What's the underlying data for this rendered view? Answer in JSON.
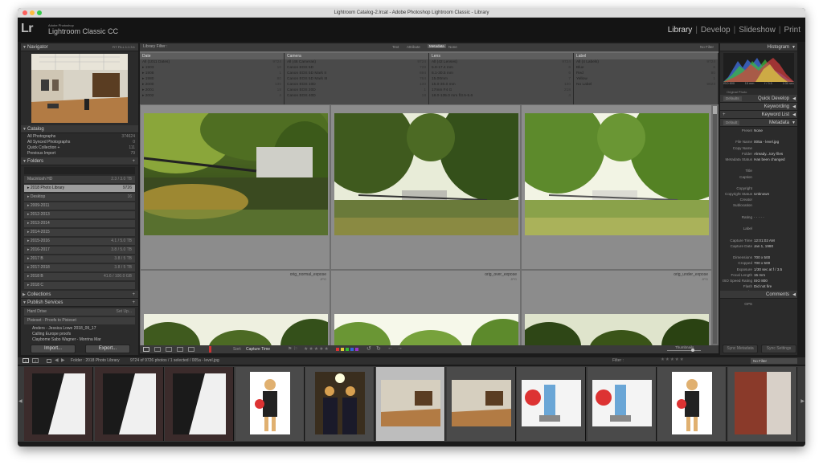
{
  "window": {
    "title": "Lightroom Catalog-2.lrcat - Adobe Photoshop Lightroom Classic - Library"
  },
  "brand": {
    "logo": "Lr",
    "line1": "Adobe Photoshop",
    "line2": "Lightroom Classic CC"
  },
  "modules": [
    {
      "label": "Library",
      "active": true
    },
    {
      "label": "Develop",
      "active": false
    },
    {
      "label": "Slideshow",
      "active": false
    },
    {
      "label": "Print",
      "active": false
    }
  ],
  "navigator": {
    "title": "Navigator",
    "zoom": "FIT   FILL   1:1   3:1"
  },
  "catalog": {
    "title": "Catalog",
    "items": [
      {
        "label": "All Photographs",
        "count": "374624"
      },
      {
        "label": "All Synced Photographs",
        "count": "0"
      },
      {
        "label": "Quick Collection +",
        "count": "111"
      },
      {
        "label": "Previous Import",
        "count": "79"
      }
    ]
  },
  "folders": {
    "title": "Folders",
    "items": [
      {
        "label": "",
        "count": "",
        "selected": false
      },
      {
        "label": "Macintosh HD",
        "count": "2.3 / 3.0 TB",
        "selected": false
      },
      {
        "label": "▸  2018 Photo Library",
        "count": "9726",
        "selected": true
      },
      {
        "label": "▸  Desktop",
        "count": "16",
        "selected": false
      },
      {
        "label": "▸  2009-2011",
        "count": "",
        "selected": false
      },
      {
        "label": "▸  2012-2013",
        "count": "",
        "selected": false
      },
      {
        "label": "▸  2013-2014",
        "count": "",
        "selected": false
      },
      {
        "label": "▸  2014-2015",
        "count": "",
        "selected": false
      },
      {
        "label": "▸  2015-2016",
        "count": "4.1 / 5.0 TB",
        "selected": false
      },
      {
        "label": "▸  2016-2017",
        "count": "3.8 / 5.0 TB",
        "selected": false
      },
      {
        "label": "▸  2017 B",
        "count": "3.8 / 5 TB",
        "selected": false
      },
      {
        "label": "▸  2017-2018",
        "count": "3.8 / 5 TB",
        "selected": false
      },
      {
        "label": "▸  2018 B",
        "count": "41.6 / 100.0 GB",
        "selected": false
      },
      {
        "label": "▸  2018 C",
        "count": "",
        "selected": false
      }
    ]
  },
  "collections": {
    "title": "Collections"
  },
  "publish": {
    "title": "Publish Services",
    "items": [
      {
        "label": "Hard Drive",
        "count": "Set Up..."
      },
      {
        "label": "Pixieset - Proofs to Pixieset",
        "count": ""
      },
      {
        "label": "Anders - Jessica Lowe 2018_09_17",
        "count": ""
      },
      {
        "label": "Calling Europe proofs",
        "count": ""
      },
      {
        "label": "Claybome Sabo Wagner - Morrina Mar",
        "count": ""
      }
    ]
  },
  "left_buttons": {
    "import": "Import...",
    "export": "Export..."
  },
  "filter_bar": {
    "title": "Library Filter :",
    "tabs": [
      "Text",
      "Attribute",
      "Metadata",
      "None"
    ],
    "active": "Metadata",
    "nofilter": "No Filter"
  },
  "filter_columns": [
    {
      "header": "Date",
      "rows": [
        {
          "label": "All (1011 Dates)",
          "count": "9724"
        },
        {
          "label": "▸ 1903",
          "count": "10"
        },
        {
          "label": "▸ 1908",
          "count": "1"
        },
        {
          "label": "▸ 1980",
          "count": "80"
        },
        {
          "label": "▸ 2000",
          "count": "130"
        },
        {
          "label": "▸ 2001",
          "count": "18"
        },
        {
          "label": "▸ 2002",
          "count": "4"
        }
      ]
    },
    {
      "header": "Camera",
      "rows": [
        {
          "label": "All (46 Cameras)",
          "count": "9724"
        },
        {
          "label": "Canon EOS 5D",
          "count": "728"
        },
        {
          "label": "Canon EOS 5D Mark II",
          "count": "694"
        },
        {
          "label": "Canon EOS 5D Mark III",
          "count": "764"
        },
        {
          "label": "Canon EOS 10D",
          "count": "130"
        },
        {
          "label": "Canon EOS 20D",
          "count": "1"
        },
        {
          "label": "Canon EOS 40D",
          "count": "18"
        }
      ]
    },
    {
      "header": "Lens",
      "rows": [
        {
          "label": "All (42 Lenses)",
          "count": "9724"
        },
        {
          "label": "5.8-17.4 mm",
          "count": "6"
        },
        {
          "label": "6.1-30.5 mm",
          "count": "6"
        },
        {
          "label": "15.00mm",
          "count": "7"
        },
        {
          "label": "15.0-30.0 mm",
          "count": "130"
        },
        {
          "label": "17mm F4 G",
          "count": "218"
        },
        {
          "label": "18.0-135.0 mm f/3.5-5.6",
          "count": "4"
        }
      ]
    },
    {
      "header": "Label",
      "rows": [
        {
          "label": "All (4 Labels)",
          "count": "9724"
        },
        {
          "label": "Blue",
          "count": "6"
        },
        {
          "label": "Red",
          "count": "80"
        },
        {
          "label": "Yellow",
          "count": "1"
        },
        {
          "label": "No Label",
          "count": "9623"
        },
        {
          "label": "",
          "count": ""
        },
        {
          "label": "",
          "count": ""
        }
      ]
    }
  ],
  "grid": {
    "cells": [
      {
        "name": "",
        "ext": ""
      },
      {
        "name": "",
        "ext": ""
      },
      {
        "name": "",
        "ext": ""
      },
      {
        "name": "orig_normal_expose",
        "ext": "JPG"
      },
      {
        "name": "orig_over_expose",
        "ext": "JPG"
      },
      {
        "name": "orig_under_expose",
        "ext": "JPG"
      }
    ]
  },
  "toolbar": {
    "sort_label": "Sort:",
    "sort_value": "Capture Time",
    "thumbnails": "Thumbnails"
  },
  "right_panel": {
    "histogram": {
      "title": "Histogram",
      "iso": "ISO 800",
      "focal": "15 mm",
      "aperture": "f / 3.5",
      "shutter": "1/30 sec",
      "original": "Original Photo"
    },
    "quick_develop": {
      "preset": "Defaults",
      "title": "Quick Develop"
    },
    "keywording": {
      "title": "Keywording"
    },
    "keyword_list": {
      "title": "Keyword List"
    },
    "metadata": {
      "preset": "Default",
      "title": "Metadata"
    },
    "meta_rows": [
      {
        "k": "Preset",
        "v": "None"
      },
      {
        "k": "",
        "v": ""
      },
      {
        "k": "File Name",
        "v": "005a - level.jpg"
      },
      {
        "k": "Copy Name",
        "v": ""
      },
      {
        "k": "Folder",
        "v": "Already...tory files"
      },
      {
        "k": "Metadata Status",
        "v": "Has been changed"
      },
      {
        "k": "",
        "v": ""
      },
      {
        "k": "Title",
        "v": ""
      },
      {
        "k": "Caption",
        "v": ""
      },
      {
        "k": "",
        "v": ""
      },
      {
        "k": "Copyright",
        "v": ""
      },
      {
        "k": "Copyright Status",
        "v": "Unknown"
      },
      {
        "k": "Creator",
        "v": ""
      },
      {
        "k": "Sublocation",
        "v": ""
      },
      {
        "k": "",
        "v": ""
      },
      {
        "k": "Rating",
        "v": "·  ·  ·  ·  ·"
      },
      {
        "k": "",
        "v": ""
      },
      {
        "k": "Label",
        "v": ""
      },
      {
        "k": "",
        "v": ""
      },
      {
        "k": "Capture Time",
        "v": "12:01:02 AM"
      },
      {
        "k": "Capture Date",
        "v": "Jan 1, 1980"
      },
      {
        "k": "",
        "v": ""
      },
      {
        "k": "Dimensions",
        "v": "700 x 500"
      },
      {
        "k": "Cropped",
        "v": "700 x 500"
      },
      {
        "k": "Exposure",
        "v": "1/30 sec at f / 3.5"
      },
      {
        "k": "Focal Length",
        "v": "15 mm"
      },
      {
        "k": "ISO Speed Rating",
        "v": "ISO 800"
      },
      {
        "k": "Flash",
        "v": "Did not fire"
      },
      {
        "k": "Make",
        "v": "Canon"
      },
      {
        "k": "Model",
        "v": "Canon EOS 10D"
      },
      {
        "k": "GPS",
        "v": ""
      }
    ],
    "comments": {
      "title": "Comments"
    },
    "sync_metadata": "Sync Metadata",
    "sync_settings": "Sync Settings"
  },
  "filmstrip": {
    "path": "Folder : 2018 Photo Library",
    "selection": "9724 of 9726 photos / 1 selected / 005a - level.jpg",
    "filter_label": "Filter :",
    "filter_value": "No Filter",
    "page1": "1",
    "page2": "2"
  }
}
